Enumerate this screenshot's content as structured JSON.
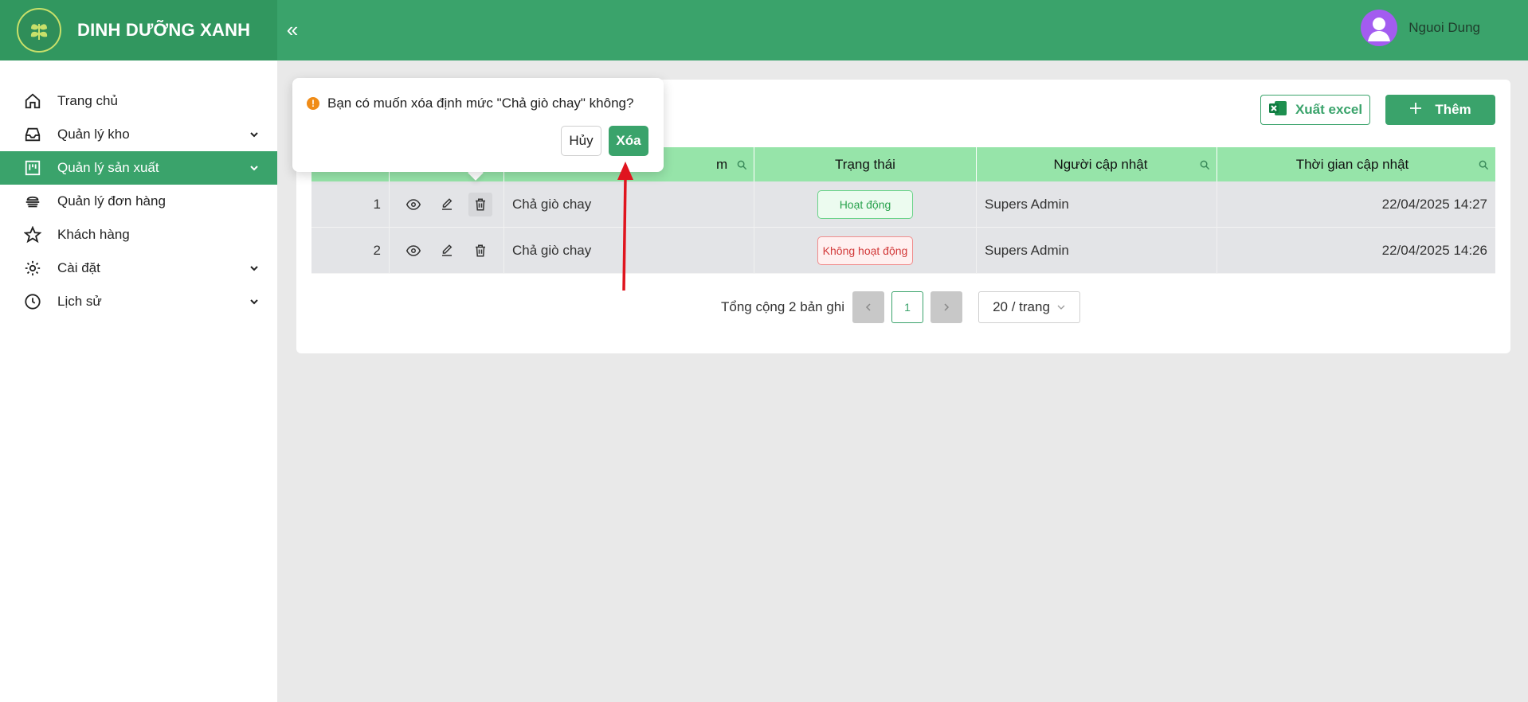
{
  "header": {
    "brand": "DINH DƯỠNG XANH",
    "user_name": "Nguoi Dung"
  },
  "sidebar": {
    "items": [
      {
        "label": "Trang chủ",
        "icon": "home-icon"
      },
      {
        "label": "Quản lý kho",
        "icon": "inbox-icon",
        "expandable": true
      },
      {
        "label": "Quản lý sản xuất",
        "icon": "production-icon",
        "expandable": true,
        "active": true
      },
      {
        "label": "Quản lý đơn hàng",
        "icon": "order-icon"
      },
      {
        "label": "Khách hàng",
        "icon": "star-icon"
      },
      {
        "label": "Cài đặt",
        "icon": "gear-icon",
        "expandable": true
      },
      {
        "label": "Lịch sử",
        "icon": "history-icon",
        "expandable": true
      }
    ]
  },
  "toolbar": {
    "excel_label": "Xuất excel",
    "add_label": "Thêm"
  },
  "table": {
    "columns": [
      "",
      "",
      "m",
      "Trạng thái",
      "Người cập nhật",
      "Thời gian cập nhật"
    ],
    "rows": [
      {
        "stt": "1",
        "name": "Chả giò chay",
        "status": "Hoạt động",
        "status_type": "active",
        "updated_by": "Supers Admin",
        "updated_at": "22/04/2025 14:27"
      },
      {
        "stt": "2",
        "name": "Chả giò chay",
        "status": "Không hoạt động",
        "status_type": "inactive",
        "updated_by": "Supers Admin",
        "updated_at": "22/04/2025 14:26"
      }
    ]
  },
  "pagination": {
    "total_text": "Tổng cộng 2 bản ghi",
    "current_page": "1",
    "page_size": "20 / trang"
  },
  "popconfirm": {
    "message": "Bạn có muốn xóa định mức \"Chả giò chay\" không?",
    "cancel_label": "Hủy",
    "confirm_label": "Xóa"
  },
  "colors": {
    "primary": "#3aa36b",
    "header_bg": "#3aa36b",
    "table_header_bg": "#96e4a9",
    "annotation_arrow": "#e0141e"
  }
}
